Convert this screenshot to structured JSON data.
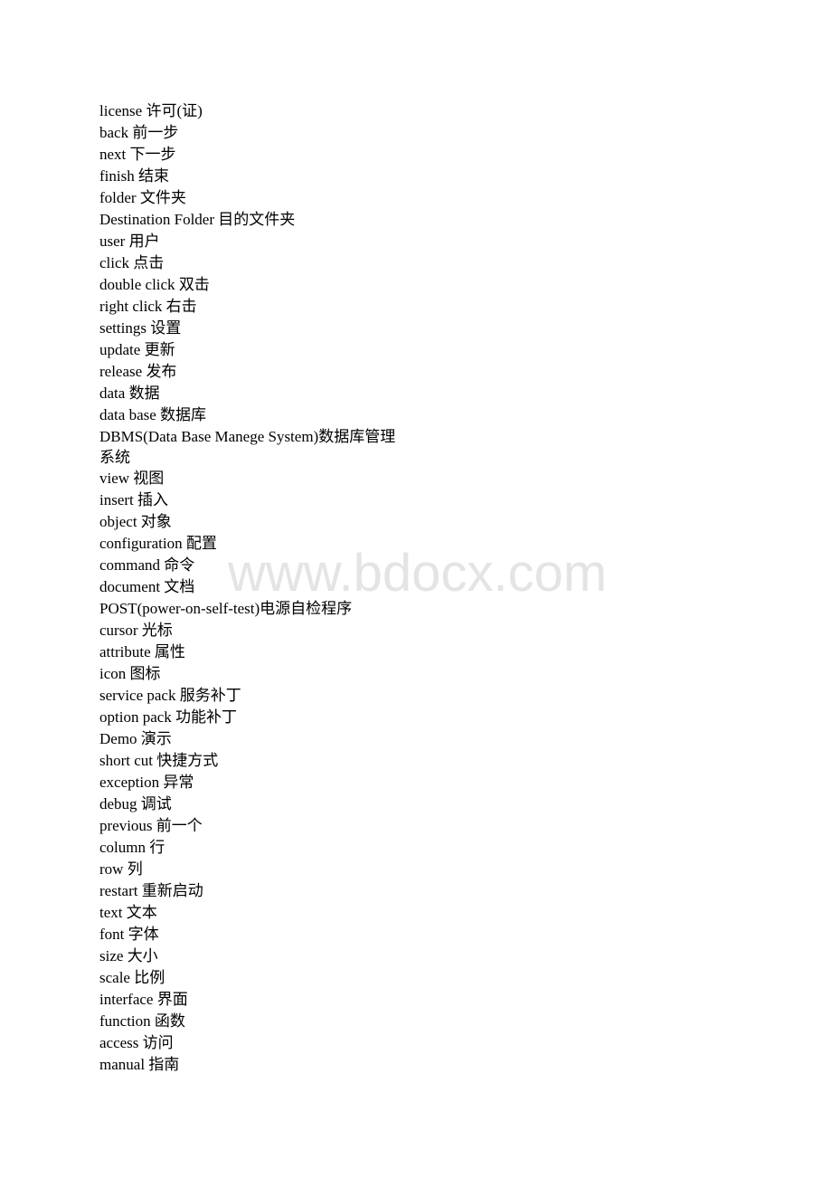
{
  "watermark": "www.bdocx.com",
  "entries": [
    {
      "en": "license",
      "zh": "许可(证)"
    },
    {
      "en": "back",
      "zh": "前一步"
    },
    {
      "en": "next",
      "zh": "下一步"
    },
    {
      "en": "finish",
      "zh": "结束"
    },
    {
      "en": "folder",
      "zh": "文件夹"
    },
    {
      "en": "Destination Folder",
      "zh": "目的文件夹"
    },
    {
      "en": "user",
      "zh": "用户"
    },
    {
      "en": "click",
      "zh": "点击"
    },
    {
      "en": "double click",
      "zh": "双击"
    },
    {
      "en": "right click",
      "zh": "右击"
    },
    {
      "en": "settings",
      "zh": "设置"
    },
    {
      "en": "update",
      "zh": "更新"
    },
    {
      "en": "release",
      "zh": "发布"
    },
    {
      "en": "data",
      "zh": "数据"
    },
    {
      "en": "data base",
      "zh": "数据库"
    },
    {
      "en": "DBMS(Data Base Manege System)",
      "zh": "数据库管理系统"
    },
    {
      "en": "view",
      "zh": "视图"
    },
    {
      "en": "insert",
      "zh": "插入"
    },
    {
      "en": "object",
      "zh": "对象"
    },
    {
      "en": "configuration",
      "zh": "配置"
    },
    {
      "en": "command",
      "zh": "命令"
    },
    {
      "en": "document",
      "zh": "文档"
    },
    {
      "en": "POST(power-on-self-test)",
      "zh": "电源自检程序"
    },
    {
      "en": "cursor",
      "zh": "光标"
    },
    {
      "en": "attribute",
      "zh": "属性"
    },
    {
      "en": "icon",
      "zh": "图标"
    },
    {
      "en": "service pack",
      "zh": "服务补丁"
    },
    {
      "en": "option pack",
      "zh": "功能补丁"
    },
    {
      "en": "Demo",
      "zh": "演示"
    },
    {
      "en": "short cut",
      "zh": "快捷方式"
    },
    {
      "en": "exception",
      "zh": "异常"
    },
    {
      "en": "debug",
      "zh": "调试"
    },
    {
      "en": "previous",
      "zh": "前一个"
    },
    {
      "en": "column",
      "zh": "行"
    },
    {
      "en": "row",
      "zh": "列"
    },
    {
      "en": "restart",
      "zh": "重新启动"
    },
    {
      "en": "text",
      "zh": "文本"
    },
    {
      "en": "font",
      "zh": "字体"
    },
    {
      "en": "size",
      "zh": "大小"
    },
    {
      "en": "scale",
      "zh": "比例"
    },
    {
      "en": "interface",
      "zh": "界面"
    },
    {
      "en": "function",
      "zh": "函数"
    },
    {
      "en": "access",
      "zh": "访问"
    },
    {
      "en": "manual",
      "zh": "指南"
    }
  ]
}
